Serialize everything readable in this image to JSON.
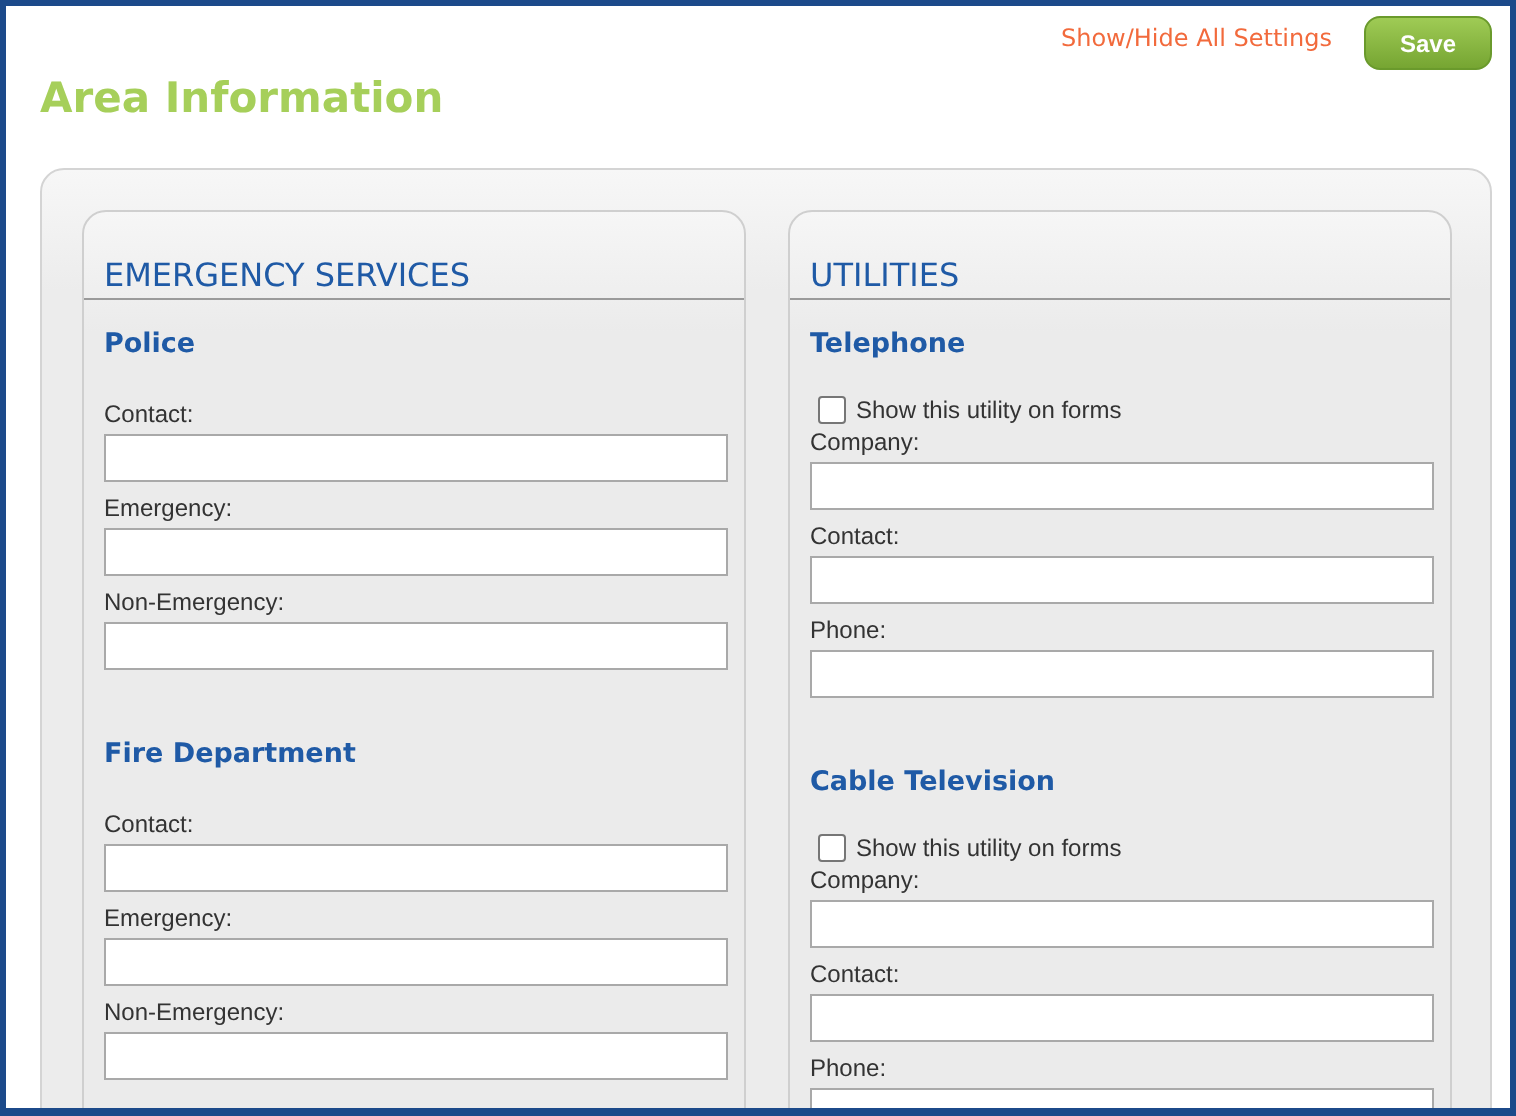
{
  "header": {
    "link": "Show/Hide All Settings",
    "save_button": "Save",
    "title": "Area Information"
  },
  "sections": [
    {
      "title": "EMERGENCY SERVICES",
      "groups": [
        {
          "title": "Police",
          "fields": [
            {
              "label": "Contact:"
            },
            {
              "label": "Emergency:"
            },
            {
              "label": "Non-Emergency:"
            }
          ]
        },
        {
          "title": "Fire Department",
          "fields": [
            {
              "label": "Contact:"
            },
            {
              "label": "Emergency:"
            },
            {
              "label": "Non-Emergency:"
            }
          ]
        }
      ]
    },
    {
      "title": "UTILITIES",
      "groups": [
        {
          "title": "Telephone",
          "show_on_forms": {
            "label": "Show this utility on forms",
            "checked": false
          },
          "fields": [
            {
              "label": "Company:"
            },
            {
              "label": "Contact:"
            },
            {
              "label": "Phone:"
            }
          ]
        },
        {
          "title": "Cable Television",
          "show_on_forms": {
            "label": "Show this utility on forms",
            "checked": false
          },
          "fields": [
            {
              "label": "Company:"
            },
            {
              "label": "Contact:"
            },
            {
              "label": "Phone:"
            }
          ]
        }
      ]
    }
  ]
}
